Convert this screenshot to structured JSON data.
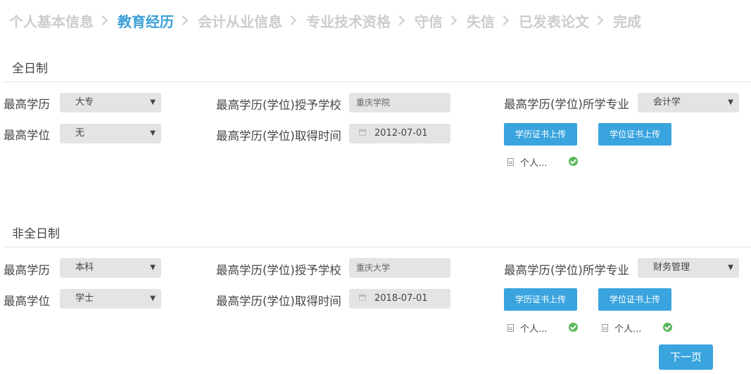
{
  "steps": [
    {
      "label": "个人基本信息",
      "active": false
    },
    {
      "label": "教育经历",
      "active": true
    },
    {
      "label": "会计从业信息",
      "active": false
    },
    {
      "label": "专业技术资格",
      "active": false
    },
    {
      "label": "守信",
      "active": false
    },
    {
      "label": "失信",
      "active": false
    },
    {
      "label": "已发表论文",
      "active": false
    },
    {
      "label": "完成",
      "active": false
    }
  ],
  "fulltime": {
    "title": "全日制",
    "highest_edu_label": "最高学历",
    "highest_edu_value": "大专",
    "highest_degree_label": "最高学位",
    "highest_degree_value": "无",
    "school_label": "最高学历(学位)授予学校",
    "school_value": "重庆学院",
    "date_label": "最高学历(学位)取得时间",
    "date_value": "2012-07-01",
    "major_label": "最高学历(学位)所学专业",
    "major_value": "会计学",
    "upload_edu": "学历证书上传",
    "upload_degree": "学位证书上传",
    "file1": "个人..."
  },
  "parttime": {
    "title": "非全日制",
    "highest_edu_label": "最高学历",
    "highest_edu_value": "本科",
    "highest_degree_label": "最高学位",
    "highest_degree_value": "学士",
    "school_label": "最高学历(学位)授予学校",
    "school_value": "重庆大学",
    "date_label": "最高学历(学位)取得时间",
    "date_value": "2018-07-01",
    "major_label": "最高学历(学位)所学专业",
    "major_value": "财务管理",
    "upload_edu": "学历证书上传",
    "upload_degree": "学位证书上传",
    "file1": "个人...",
    "file2": "个人..."
  },
  "next_label": "下一页",
  "colors": {
    "accent": "#3aa4de",
    "success": "#5cb85c",
    "inactive_step": "#cccccc"
  }
}
